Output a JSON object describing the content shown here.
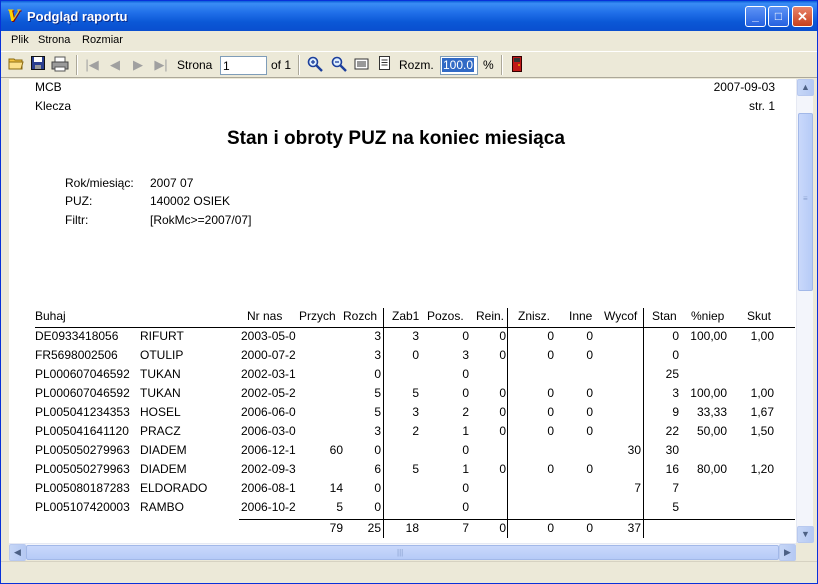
{
  "window": {
    "title": "Podgląd raportu",
    "minimize": "_",
    "maximize": "□",
    "close": "✕"
  },
  "menu": {
    "items": [
      "Plik",
      "Strona",
      "Rozmiar"
    ]
  },
  "toolbar": {
    "page_label": "Strona",
    "page_value": "1",
    "page_of": "of 1",
    "size_label": "Rozm.",
    "zoom_value": "100.0",
    "percent": "%"
  },
  "report": {
    "company": "MCB",
    "date": "2007-09-03",
    "location": "Klecza",
    "page": "str. 1",
    "title": "Stan i obroty PUZ na koniec miesiąca",
    "params": [
      {
        "label": "Rok/miesiąc:",
        "value": "2007  07"
      },
      {
        "label": "PUZ:",
        "value": "140002  OSIEK"
      },
      {
        "label": "Filtr:",
        "value": "[RokMc>=2007/07]"
      }
    ]
  },
  "table": {
    "headers": [
      "Buhaj",
      "Nr nas",
      "Przych",
      "Rozch",
      "Zab1",
      "Pozos.",
      "Rein.",
      "Znisz.",
      "Inne",
      "Wycof",
      "Stan",
      "%niep",
      "Skut"
    ],
    "rows": [
      [
        "DE0933418056",
        "RIFURT",
        "2003-05-0",
        "",
        "3",
        "3",
        "0",
        "0",
        "0",
        "0",
        "",
        "0",
        "100,00",
        "1,00"
      ],
      [
        "FR5698002506",
        "OTULIP",
        "2000-07-2",
        "",
        "3",
        "0",
        "3",
        "0",
        "0",
        "0",
        "",
        "0",
        "",
        ""
      ],
      [
        "PL000607046592",
        "TUKAN",
        "2002-03-1",
        "",
        "0",
        "",
        "0",
        "",
        "",
        "",
        "",
        "25",
        "",
        ""
      ],
      [
        "PL000607046592",
        "TUKAN",
        "2002-05-2",
        "",
        "5",
        "5",
        "0",
        "0",
        "0",
        "0",
        "",
        "3",
        "100,00",
        "1,00"
      ],
      [
        "PL005041234353",
        "HOSEL",
        "2006-06-0",
        "",
        "5",
        "3",
        "2",
        "0",
        "0",
        "0",
        "",
        "9",
        "33,33",
        "1,67"
      ],
      [
        "PL005041641120",
        "PRACZ",
        "2006-03-0",
        "",
        "3",
        "2",
        "1",
        "0",
        "0",
        "0",
        "",
        "22",
        "50,00",
        "1,50"
      ],
      [
        "PL005050279963",
        "DIADEM",
        "2006-12-1",
        "60",
        "0",
        "",
        "0",
        "",
        "",
        "",
        "30",
        "30",
        "",
        ""
      ],
      [
        "PL005050279963",
        "DIADEM",
        "2002-09-3",
        "",
        "6",
        "5",
        "1",
        "0",
        "0",
        "0",
        "",
        "16",
        "80,00",
        "1,20"
      ],
      [
        "PL005080187283",
        "ELDORADO",
        "2006-08-1",
        "14",
        "0",
        "",
        "0",
        "",
        "",
        "",
        "7",
        "7",
        "",
        ""
      ],
      [
        "PL005107420003",
        "RAMBO",
        "2006-10-2",
        "5",
        "0",
        "",
        "0",
        "",
        "",
        "",
        "",
        "5",
        "",
        ""
      ]
    ],
    "totals": [
      "79",
      "25",
      "18",
      "7",
      "0",
      "0",
      "0",
      "37"
    ]
  }
}
